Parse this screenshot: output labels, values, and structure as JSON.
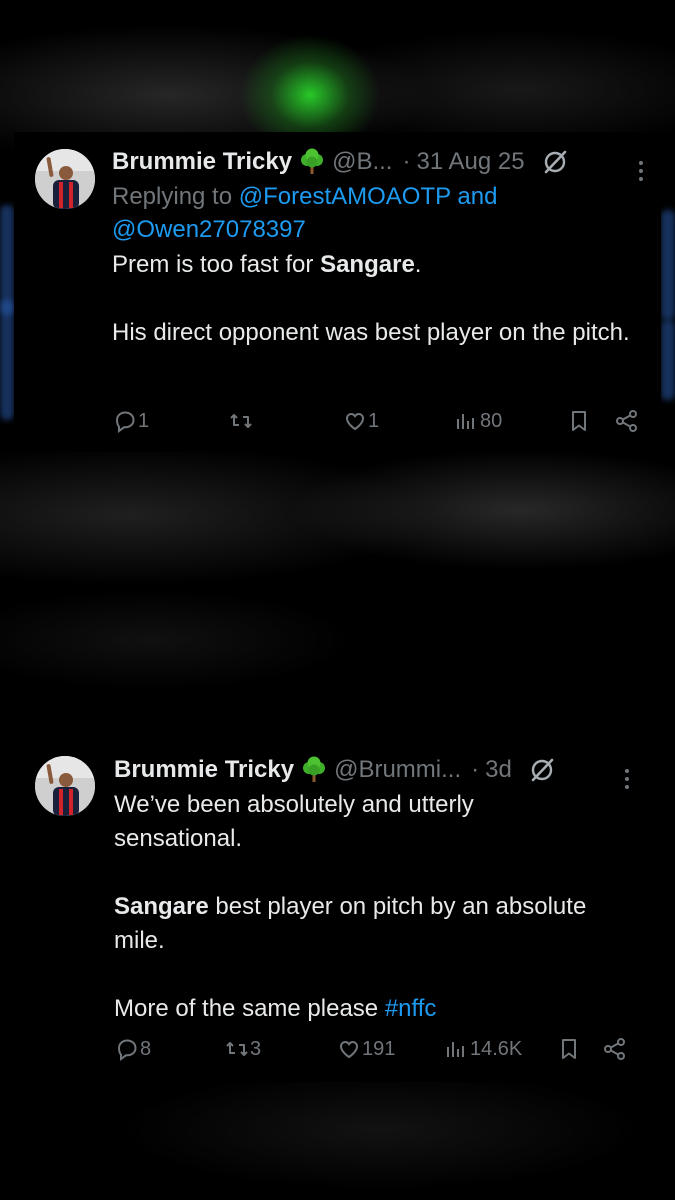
{
  "tweets": [
    {
      "author": "Brummie Tricky",
      "handle": "@B...",
      "separator": "·",
      "date": "31 Aug 25",
      "replying_prefix": "Replying to",
      "replying_users": "@ForestAMOAOTP and",
      "replying_users_2": "@Owen27078397",
      "line1_pre": "Prem is too fast for ",
      "line1_bold": "Sangare",
      "line1_post": ".",
      "line2": "His direct opponent was best player on the pitch.",
      "replies": "1",
      "reposts": "",
      "likes": "1",
      "views": "80"
    },
    {
      "author": "Brummie Tricky",
      "handle": "@Brummi...",
      "separator": "·",
      "date": "3d",
      "line1": "We’ve been absolutely and utterly sensational.",
      "line2_bold": "Sangare",
      "line2_post": " best player on pitch by an absolute mile.",
      "line3_pre": "More of the same please ",
      "line3_hashtag": "#nffc",
      "replies": "8",
      "reposts": "3",
      "likes": "191",
      "views": "14.6K"
    }
  ],
  "icons": {
    "emoji": "tree-emoji-icon",
    "grok": "grok-slash-icon",
    "more": "more-vertical-icon",
    "reply": "reply-icon",
    "repost": "repost-icon",
    "like": "heart-icon",
    "views": "views-chart-icon",
    "bookmark": "bookmark-icon",
    "share": "share-icon"
  },
  "colors": {
    "background": "#000000",
    "text": "#e7e9ea",
    "muted": "#71767b",
    "link": "#1d9bf0",
    "glow": "#28d228"
  }
}
